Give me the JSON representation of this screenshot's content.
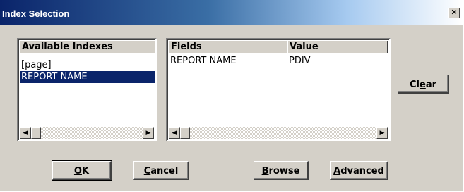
{
  "window": {
    "title": "Index Selection",
    "close_glyph": "✕"
  },
  "available_indexes": {
    "header": "Available Indexes",
    "items": [
      "[page]",
      "REPORT NAME"
    ],
    "selected_index": 1
  },
  "fields_table": {
    "columns": [
      "Fields",
      "Value"
    ],
    "rows": [
      {
        "field": "REPORT NAME",
        "value": "PDIV"
      }
    ]
  },
  "buttons": {
    "clear": {
      "pre": "Cl",
      "acc": "e",
      "post": "ar"
    },
    "ok": {
      "pre": "",
      "acc": "O",
      "post": "K"
    },
    "cancel": {
      "pre": "",
      "acc": "C",
      "post": "ancel"
    },
    "browse": {
      "pre": "",
      "acc": "B",
      "post": "rowse"
    },
    "advanced": {
      "pre": "",
      "acc": "A",
      "post": "dvanced"
    }
  },
  "icons": {
    "scroll_left": "◀",
    "scroll_right": "▶"
  }
}
